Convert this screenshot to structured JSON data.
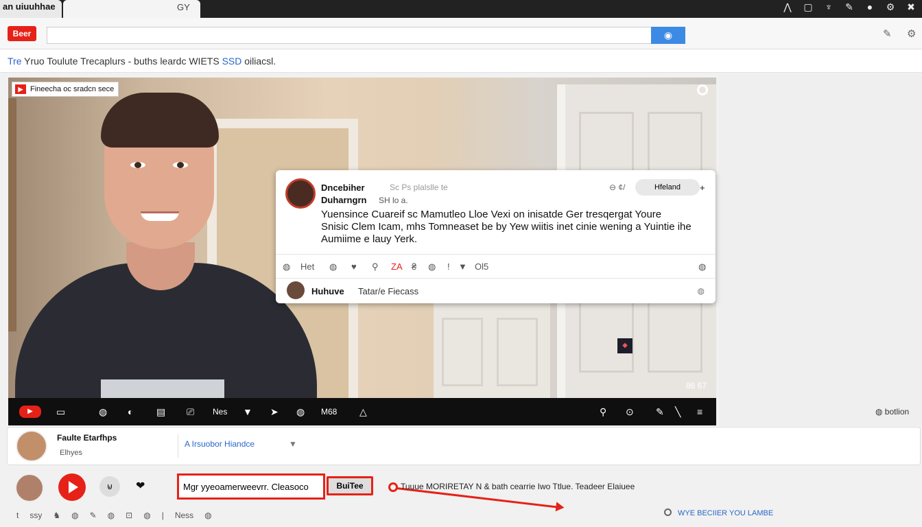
{
  "tabs": [
    {
      "label": "an uiuuhhae"
    },
    {
      "label": "GY"
    }
  ],
  "window_icons": [
    "⋀",
    "▢",
    "♆",
    "✎",
    "●",
    "⚙",
    "✖"
  ],
  "toolbar": {
    "logo_text": "Beer",
    "search_placeholder": "",
    "search_icon": "◉",
    "icon_settings": "✎",
    "icon_gear": "⚙"
  },
  "page": {
    "title_prefix": "Tre",
    "title": "Yruo Toulute Trecaplurs",
    "title_suffix": "- buths leardc WIETS",
    "title_highlight": "SSD",
    "title_end": "oiliacsl."
  },
  "video": {
    "channel_badge": "Fineecha oc sradcn sece",
    "time": "86 67",
    "controls": [
      "▭",
      "◍",
      "◐",
      "▤",
      "⎚",
      "Nes",
      "▼",
      "➤",
      "◍",
      "M68",
      "△"
    ],
    "live": "▶",
    "controls_right": [
      "⚲",
      "⊙",
      "✎",
      "╲",
      "≡"
    ]
  },
  "card": {
    "name": "Dncebiher",
    "meta": "Sc Ps plalslle te",
    "sub_name": "Duharngrn",
    "sub_meta": "SH lo a.",
    "top_icon": "⊖ ¢/",
    "follow_label": "Hfeland",
    "plus": "+",
    "text": "Yuensince Cuareif sc Mamutleo Lloe Vexi on inisatde Ger tresqergat Youre Snisic Clem Icam, mhs Tomneaset be by Yew wiitis inet cinie wening a Yuintie ihe Aumiime e lauy Yerk.",
    "actions": [
      "◍",
      "Het",
      "◍",
      "♥",
      "⚲",
      "ZA",
      "₴",
      "◍",
      "!",
      "▼",
      "Ol5"
    ],
    "action_right": "◍",
    "reply_name": "Huhuve",
    "reply_text": "Tatar/e Fiecass",
    "reply_icon": "◍"
  },
  "right_link": "◍ botlion",
  "info": {
    "name": "Faulte Etarfhps",
    "sub": "Elhyes",
    "link": "A Irsuobor Hiandce",
    "link_icon": "▼"
  },
  "bottom": {
    "round_btn": "⊌",
    "heart": "❤",
    "comment_value": "Mgr yyeoamerweevrr. Cleasoco",
    "share_label": "BuiTee",
    "arrow_text": "Tuuue MORIRETAY N & bath cearrie Iwo Ttlue. Teadeer Elaiuee",
    "icons": [
      "t",
      "ssy",
      "♞",
      "◍",
      "✎",
      "◍",
      "⊡",
      "◍",
      "|",
      "Ness",
      "◍"
    ],
    "link": "WYE BECIIER YOU LAMBE"
  }
}
